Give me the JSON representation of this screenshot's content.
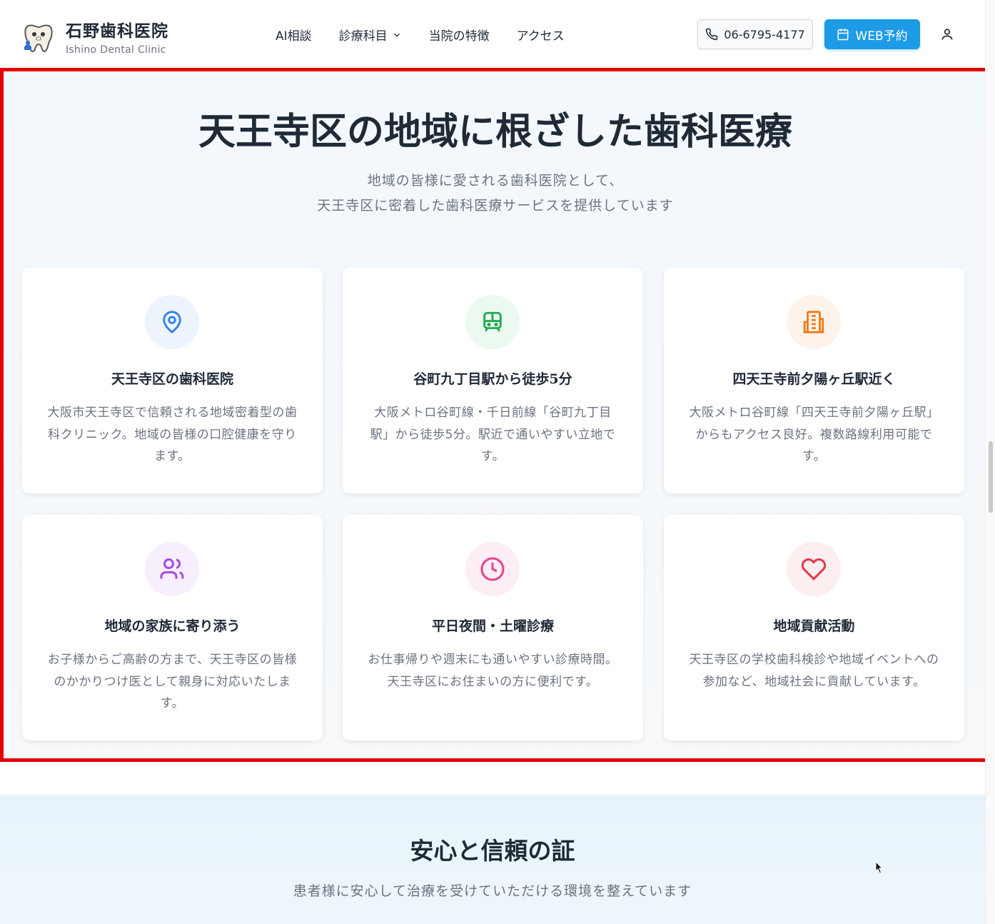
{
  "header": {
    "brand_name": "石野歯科医院",
    "brand_sub": "Ishino Dental Clinic",
    "nav": [
      {
        "label": "AI相談"
      },
      {
        "label": "診療科目"
      },
      {
        "label": "当院の特徴"
      },
      {
        "label": "アクセス"
      }
    ],
    "phone": "06-6795-4177",
    "web_booking": "WEB予約"
  },
  "hero": {
    "title": "天王寺区の地域に根ざした歯科医療",
    "subtitle_line1": "地域の皆様に愛される歯科医院として、",
    "subtitle_line2": "天王寺区に密着した歯科医療サービスを提供しています"
  },
  "features": [
    {
      "title": "天王寺区の歯科医院",
      "text": "大阪市天王寺区で信頼される地域密着型の歯科クリニック。地域の皆様の口腔健康を守ります。",
      "icon": "map-pin-icon",
      "color": "#2f80e8",
      "bg": "#edf4fe"
    },
    {
      "title": "谷町九丁目駅から徒歩5分",
      "text": "大阪メトロ谷町線・千日前線「谷町九丁目駅」から徒歩5分。駅近で通いやすい立地です。",
      "icon": "train-icon",
      "color": "#22a94f",
      "bg": "#ebf9f0"
    },
    {
      "title": "四天王寺前夕陽ヶ丘駅近く",
      "text": "大阪メトロ谷町線「四天王寺前夕陽ヶ丘駅」からもアクセス良好。複数路線利用可能です。",
      "icon": "building-icon",
      "color": "#ef7a1a",
      "bg": "#fef3ea"
    },
    {
      "title": "地域の家族に寄り添う",
      "text": "お子様からご高齢の方まで、天王寺区の皆様のかかりつけ医として親身に対応いたします。",
      "icon": "users-icon",
      "color": "#a54de8",
      "bg": "#f7effd"
    },
    {
      "title": "平日夜間・土曜診療",
      "text": "お仕事帰りや週末にも通いやすい診療時間。天王寺区にお住まいの方に便利です。",
      "icon": "clock-icon",
      "color": "#e6408f",
      "bg": "#fdeef5"
    },
    {
      "title": "地域貢献活動",
      "text": "天王寺区の学校歯科検診や地域イベントへの参加など、地域社会に貢献しています。",
      "icon": "heart-icon",
      "color": "#e5374a",
      "bg": "#fdeeef"
    }
  ],
  "next_section": {
    "title": "安心と信頼の証",
    "subtitle": "患者様に安心して治療を受けていただける環境を整えています"
  }
}
